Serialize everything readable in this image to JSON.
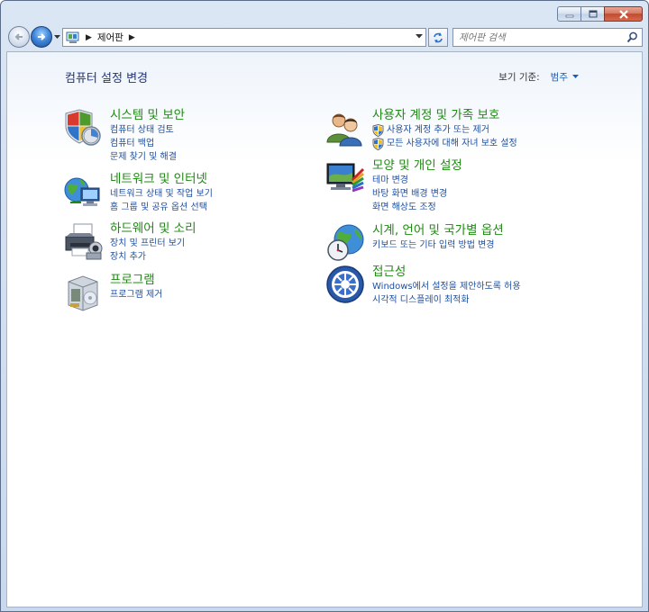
{
  "address": {
    "breadcrumb": "제어판"
  },
  "search": {
    "placeholder": "제어판 검색"
  },
  "page": {
    "title": "컴퓨터 설정 변경"
  },
  "view_by": {
    "label": "보기 기준:",
    "value": "범주"
  },
  "categories": [
    {
      "title": "시스템 및 보안",
      "links": [
        "컴퓨터 상태 검토",
        "컴퓨터 백업",
        "문제 찾기 및 해결"
      ]
    },
    {
      "title": "네트워크 및 인터넷",
      "links": [
        "네트워크 상태 및 작업 보기",
        "홈 그룹 및 공유 옵션 선택"
      ]
    },
    {
      "title": "하드웨어 및 소리",
      "links": [
        "장치 및 프린터 보기",
        "장치 추가"
      ]
    },
    {
      "title": "프로그램",
      "links": [
        "프로그램 제거"
      ]
    },
    {
      "title": "사용자 계정 및 가족 보호",
      "links": [
        "사용자 계정 추가 또는 제거",
        "모든 사용자에 대해 자녀 보호 설정"
      ]
    },
    {
      "title": "모양 및 개인 설정",
      "links": [
        "테마 변경",
        "바탕 화면 배경 변경",
        "화면 해상도 조정"
      ]
    },
    {
      "title": "시계, 언어 및 국가별 옵션",
      "links": [
        "키보드 또는 기타 입력 방법 변경"
      ]
    },
    {
      "title": "접근성",
      "links": [
        "Windows에서 설정을 제안하도록 허용",
        "시각적 디스플레이 최적화"
      ]
    }
  ]
}
